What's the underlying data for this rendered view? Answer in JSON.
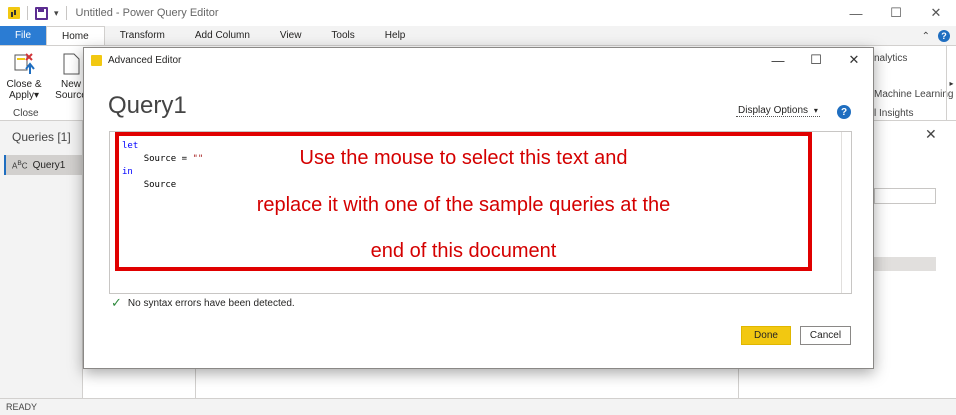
{
  "window": {
    "title": "Untitled - Power Query Editor",
    "minimize": "—",
    "maximize": "☐",
    "close": "✕"
  },
  "ribbon": {
    "tabs": [
      "File",
      "Home",
      "Transform",
      "Add Column",
      "View",
      "Tools",
      "Help"
    ],
    "active_tab": "Home",
    "close_apply_label": "Close &",
    "close_apply_label2": "Apply",
    "new_source_label": "New",
    "new_source_label2": "Source",
    "close_group": "Close",
    "analytics": "nalytics",
    "machine_learning": "Machine Learning",
    "insights": "l Insights"
  },
  "queries_panel": {
    "title": "Queries [1]",
    "items": [
      "Query1"
    ]
  },
  "dialog": {
    "title": "Advanced Editor",
    "query_name": "Query1",
    "display_options": "Display Options",
    "help": "?",
    "code": {
      "line1": "let",
      "line2_name": "Source = ",
      "line2_value": "\"\"",
      "line3": "in",
      "line4": "Source"
    },
    "annotation_lines": [
      "Use the mouse to select this text and",
      "replace it with one of the sample queries at the",
      "end of this document"
    ],
    "syntax_status": "No syntax errors have been detected.",
    "done_label": "Done",
    "cancel_label": "Cancel"
  },
  "status_bar": {
    "text": "READY"
  },
  "colors": {
    "accent_blue": "#2b7cd3",
    "done_yellow": "#f2c811",
    "annotation_red": "#e00000",
    "ok_green": "#2f8a3e"
  }
}
